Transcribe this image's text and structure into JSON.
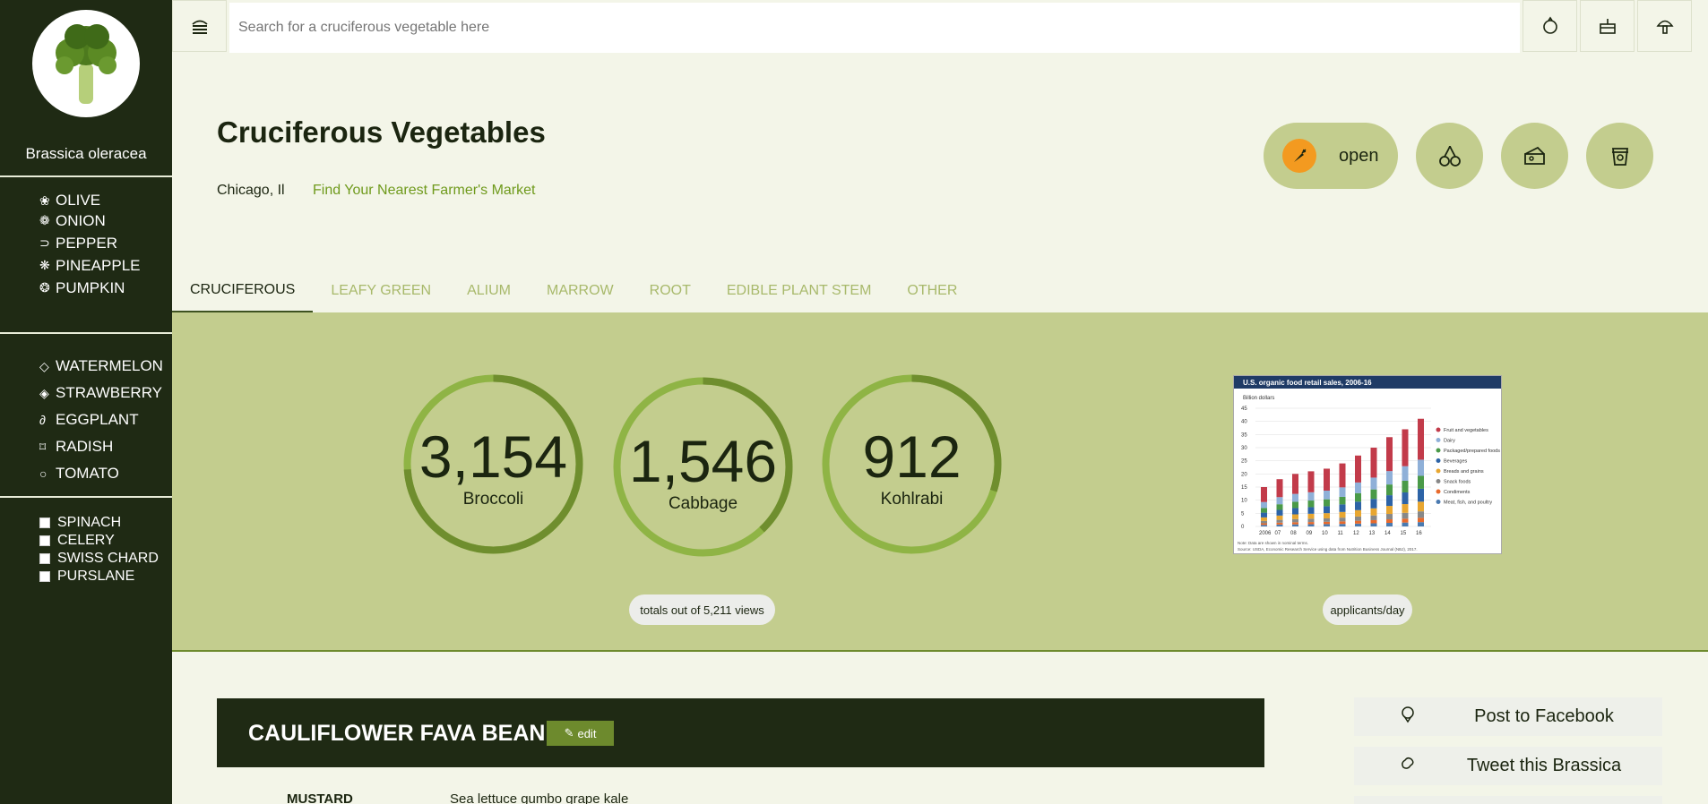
{
  "sidebar": {
    "name": "Brassica oleracea",
    "group1": [
      {
        "label": "OLIVE",
        "icon": "olive-icon",
        "glyph": "❀"
      },
      {
        "label": "ONION",
        "icon": "onion-icon",
        "glyph": "❁"
      },
      {
        "label": "PEPPER",
        "icon": "pepper-icon",
        "glyph": "⊃"
      },
      {
        "label": "PINEAPPLE",
        "icon": "pineapple-icon",
        "glyph": "❋"
      },
      {
        "label": "PUMPKIN",
        "icon": "pumpkin-icon",
        "glyph": "❂"
      }
    ],
    "group2": [
      {
        "label": "WATERMELON",
        "icon": "watermelon-icon",
        "glyph": "◇"
      },
      {
        "label": "STRAWBERRY",
        "icon": "strawberry-icon",
        "glyph": "◈"
      },
      {
        "label": "EGGPLANT",
        "icon": "eggplant-icon",
        "glyph": "∂"
      },
      {
        "label": "RADISH",
        "icon": "radish-icon",
        "glyph": "⌑"
      },
      {
        "label": "TOMATO",
        "icon": "tomato-icon",
        "glyph": "○"
      }
    ],
    "checks": [
      "SPINACH",
      "CELERY",
      "SWISS CHARD",
      "PURSLANE"
    ]
  },
  "search": {
    "placeholder": "Search for a cruciferous vegetable here"
  },
  "header": {
    "title": "Cruciferous Vegetables",
    "location": "Chicago, Il",
    "market_link": "Find Your Nearest Farmer's Market",
    "open_label": "open"
  },
  "tabs": [
    "CRUCIFEROUS",
    "LEAFY GREEN",
    "ALIUM",
    "MARROW",
    "ROOT",
    "EDIBLE PLANT STEM",
    "OTHER"
  ],
  "stats": [
    {
      "value": "3,154",
      "label": "Broccoli",
      "fraction": 0.74
    },
    {
      "value": "1,546",
      "label": "Cabbage",
      "fraction": 0.38
    },
    {
      "value": "912",
      "label": "Kohlrabi",
      "fraction": 0.3
    }
  ],
  "notes": {
    "totals": "totals out of 5,211 views",
    "applicants": "applicants/day"
  },
  "colors": {
    "sidebar": "#1f2a14",
    "band": "#c3cd8e",
    "accent": "#6d8a2d",
    "link": "#6f9a1c",
    "ring_light": "#8fb445",
    "ring_dark": "#6f8e2e"
  },
  "mini_chart": {
    "title": "U.S. organic food retail sales, 2006-16",
    "unit": "Billion dollars",
    "legend": [
      "Fruit and vegetables",
      "Dairy",
      "Packaged/prepared foods",
      "Beverages",
      "Breads and grains",
      "Snack foods",
      "Condiments",
      "Meat, fish, and poultry"
    ],
    "x": [
      "2006",
      "07",
      "08",
      "09",
      "10",
      "11",
      "12",
      "13",
      "14",
      "15",
      "16"
    ],
    "y_ticks": [
      "45",
      "40",
      "35",
      "30",
      "25",
      "20",
      "15",
      "10",
      "5",
      "0"
    ],
    "totals": [
      15,
      18,
      20,
      21,
      22,
      24,
      27,
      30,
      34,
      37,
      41
    ],
    "note": "Note: Data are shown in nominal terms.",
    "source": "Source: USDA, Economic Research Service using data from Nutrition Business Journal (NBJ), 2017."
  },
  "card": {
    "title": "CAULIFLOWER FAVA BEAN",
    "edit": "edit",
    "key": "MUSTARD",
    "value": "Sea lettuce gumbo grape kale"
  },
  "share": {
    "facebook": "Post to Facebook",
    "tweet": "Tweet this Brassica"
  }
}
